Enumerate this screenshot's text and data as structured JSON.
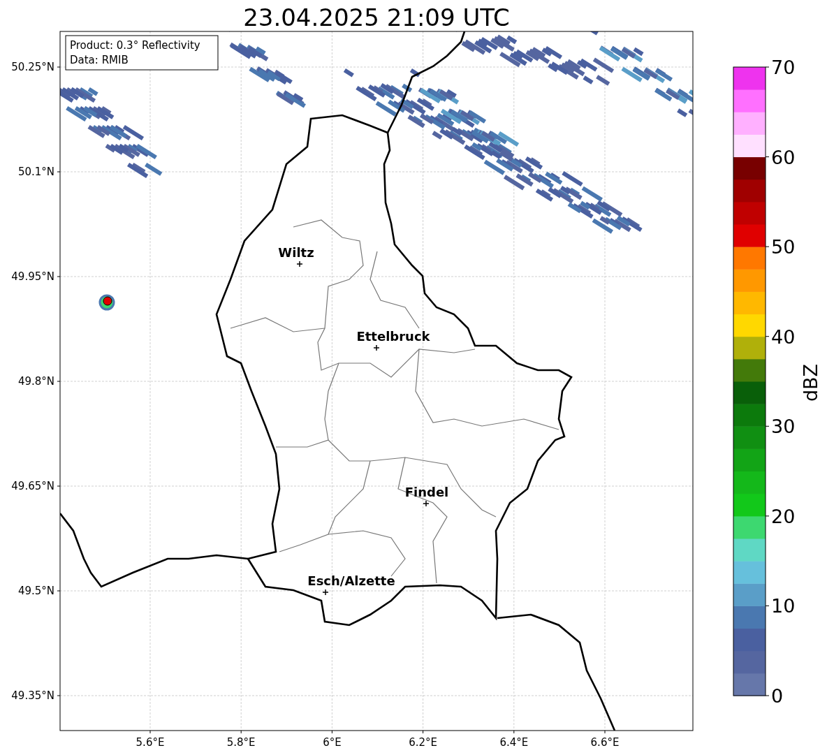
{
  "title": "23.04.2025 21:09 UTC",
  "info_box": [
    "Product: 0.3° Reflectivity",
    "Data: RMIB"
  ],
  "y_axis_ticks": [
    "50.25°N",
    "50.1°N",
    "49.95°N",
    "49.8°N",
    "49.65°N",
    "49.5°N",
    "49.35°N"
  ],
  "x_axis_ticks": [
    "5.6°E",
    "5.8°E",
    "6°E",
    "6.2°E",
    "6.4°E",
    "6.6°E"
  ],
  "cities": [
    {
      "name": "Wiltz"
    },
    {
      "name": "Ettelbruck"
    },
    {
      "name": "Findel"
    },
    {
      "name": "Esch/Alzette"
    }
  ],
  "colorbar": {
    "label": "dBZ",
    "ticks": [
      "70",
      "60",
      "50",
      "40",
      "30",
      "20",
      "10",
      "0"
    ],
    "bands": [
      {
        "color": "#6677aa"
      },
      {
        "color": "#5566a0"
      },
      {
        "color": "#4a60a0"
      },
      {
        "color": "#4a78b0"
      },
      {
        "color": "#5a9ec8"
      },
      {
        "color": "#66c0dc"
      },
      {
        "color": "#5fd8c4"
      },
      {
        "color": "#3dd870"
      },
      {
        "color": "#12c81a"
      },
      {
        "color": "#14b81a"
      },
      {
        "color": "#12a416"
      },
      {
        "color": "#108f12"
      },
      {
        "color": "#0c7a0c"
      },
      {
        "color": "#095f09"
      },
      {
        "color": "#437a0a"
      },
      {
        "color": "#b0b00a"
      },
      {
        "color": "#ffd800"
      },
      {
        "color": "#ffb800"
      },
      {
        "color": "#ff9800"
      },
      {
        "color": "#ff7800"
      },
      {
        "color": "#e00000"
      },
      {
        "color": "#c00000"
      },
      {
        "color": "#a00000"
      },
      {
        "color": "#780000"
      },
      {
        "color": "#ffe0ff"
      },
      {
        "color": "#ffb0ff"
      },
      {
        "color": "#ff70ff"
      },
      {
        "color": "#ee33ee"
      }
    ]
  }
}
